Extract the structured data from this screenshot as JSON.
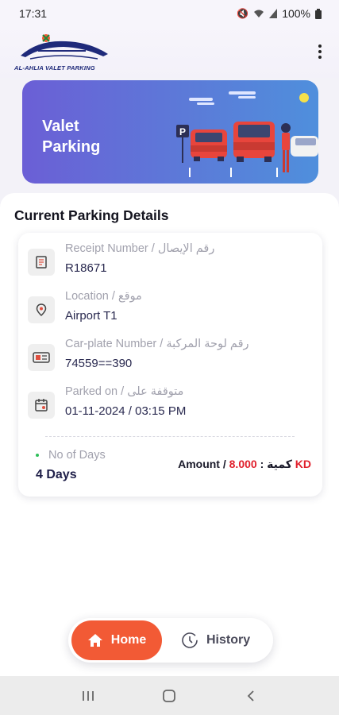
{
  "status_bar": {
    "time": "17:31",
    "battery": "100%"
  },
  "header": {
    "logo_text": "AL-AHLIA VALET PARKING"
  },
  "banner": {
    "title": "Valet Parking"
  },
  "main": {
    "section_title": "Current Parking Details",
    "rows": [
      {
        "label": "Receipt Number / رقم الإيصال",
        "value": "R18671",
        "icon": "receipt-icon"
      },
      {
        "label": "Location / موقع",
        "value": "Airport T1",
        "icon": "location-pin-icon"
      },
      {
        "label": "Car-plate Number / رقم لوحة المركبة",
        "value": "74559==390",
        "icon": "car-plate-icon"
      },
      {
        "label": "Parked on / متوقفة على",
        "value": "01-11-2024 / 03:15 PM",
        "icon": "calendar-icon"
      }
    ],
    "days_label": "No of Days",
    "days_value": "4 Days",
    "amount_label": "Amount / كمية :",
    "amount_value": "8.000 KD"
  },
  "bottom_nav": {
    "home_label": "Home",
    "history_label": "History"
  },
  "colors": {
    "accent": "#f25a35",
    "amount": "#e0202c",
    "banner_start": "#6b5fd6",
    "banner_end": "#4f8fdc"
  }
}
